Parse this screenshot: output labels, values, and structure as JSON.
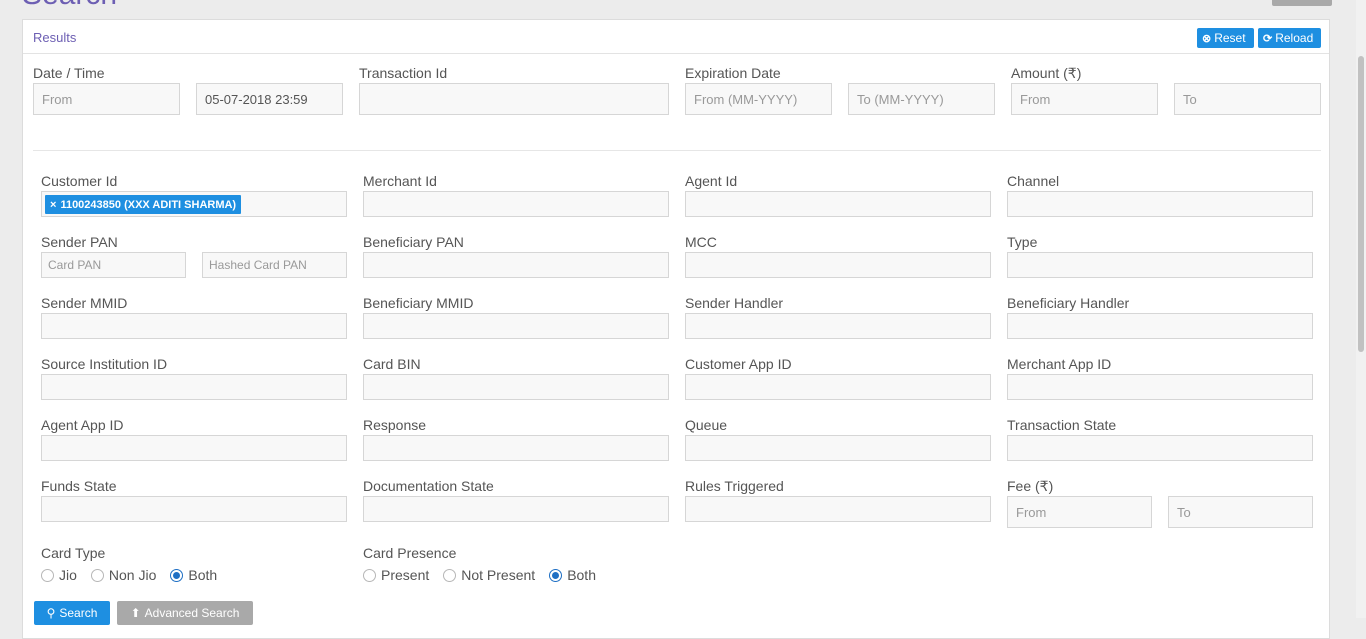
{
  "page": {
    "title": "Search"
  },
  "panel": {
    "title": "Results",
    "reset_label": "Reset",
    "reload_label": "Reload"
  },
  "top_row": {
    "date_time": {
      "label": "Date / Time",
      "from_placeholder": "From",
      "to_value": "05-07-2018 23:59"
    },
    "transaction_id": {
      "label": "Transaction Id"
    },
    "expiration_date": {
      "label": "Expiration Date",
      "from_placeholder": "From (MM-YYYY)",
      "to_placeholder": "To (MM-YYYY)"
    },
    "amount": {
      "label": "Amount (₹)",
      "from_placeholder": "From",
      "to_placeholder": "To"
    }
  },
  "fields": {
    "customer_id": {
      "label": "Customer Id",
      "tag": "1100243850 (XXX ADITI SHARMA)"
    },
    "merchant_id": {
      "label": "Merchant Id"
    },
    "agent_id": {
      "label": "Agent Id"
    },
    "channel": {
      "label": "Channel"
    },
    "sender_pan": {
      "label": "Sender PAN",
      "card_pan_placeholder": "Card PAN",
      "hashed_placeholder": "Hashed Card PAN"
    },
    "beneficiary_pan": {
      "label": "Beneficiary PAN"
    },
    "mcc": {
      "label": "MCC"
    },
    "type": {
      "label": "Type"
    },
    "sender_mmid": {
      "label": "Sender MMID"
    },
    "beneficiary_mmid": {
      "label": "Beneficiary MMID"
    },
    "sender_handler": {
      "label": "Sender Handler"
    },
    "beneficiary_handler": {
      "label": "Beneficiary Handler"
    },
    "source_institution_id": {
      "label": "Source Institution ID"
    },
    "card_bin": {
      "label": "Card BIN"
    },
    "customer_app_id": {
      "label": "Customer App ID"
    },
    "merchant_app_id": {
      "label": "Merchant App ID"
    },
    "agent_app_id": {
      "label": "Agent App ID"
    },
    "response": {
      "label": "Response"
    },
    "queue": {
      "label": "Queue"
    },
    "transaction_state": {
      "label": "Transaction State"
    },
    "funds_state": {
      "label": "Funds State"
    },
    "documentation_state": {
      "label": "Documentation State"
    },
    "rules_triggered": {
      "label": "Rules Triggered"
    },
    "fee": {
      "label": "Fee (₹)",
      "from_placeholder": "From",
      "to_placeholder": "To"
    }
  },
  "card_type": {
    "label": "Card Type",
    "options": [
      "Jio",
      "Non Jio",
      "Both"
    ],
    "selected": "Both"
  },
  "card_presence": {
    "label": "Card Presence",
    "options": [
      "Present",
      "Not Present",
      "Both"
    ],
    "selected": "Both"
  },
  "actions": {
    "search_label": "Search",
    "advanced_label": "Advanced Search"
  },
  "colors": {
    "accent": "#1e8fe1",
    "title": "#6d5fb3",
    "secondary": "#a9a9a9"
  }
}
